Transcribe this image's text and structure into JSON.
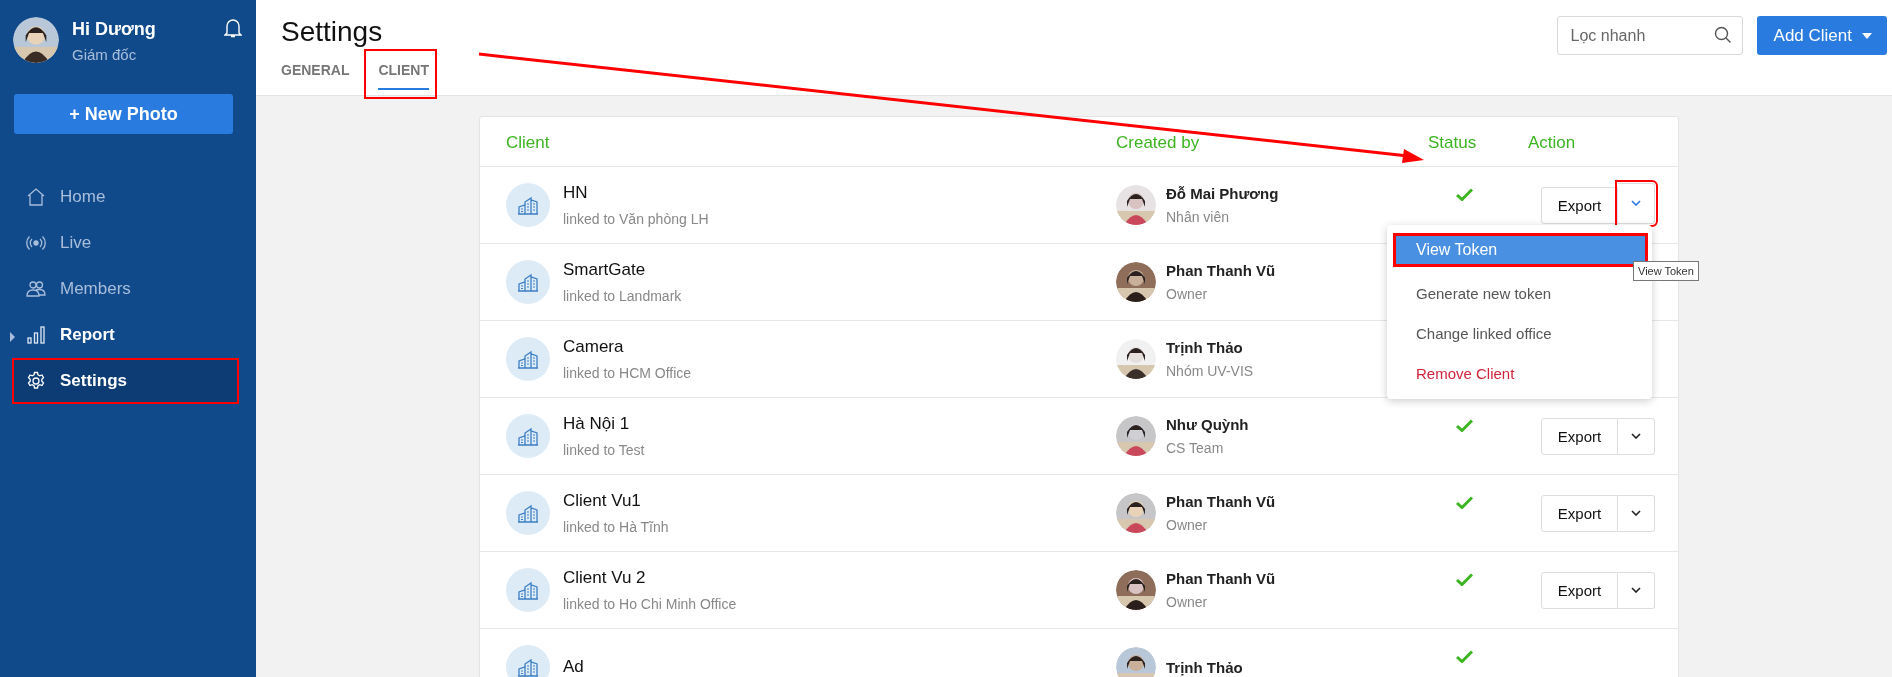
{
  "sidebar": {
    "user": {
      "name": "Hi Dương",
      "role": "Giám đốc"
    },
    "new_button": "+ New Photo",
    "items": [
      {
        "label": "Home",
        "kind": "link",
        "selected": false,
        "highlighted": false
      },
      {
        "label": "Live",
        "kind": "link",
        "selected": false,
        "highlighted": false
      },
      {
        "label": "Members",
        "kind": "link",
        "selected": false,
        "highlighted": false
      },
      {
        "label": "Report",
        "kind": "group",
        "expanded": false,
        "selected": false,
        "highlighted": false
      },
      {
        "label": "Settings",
        "kind": "link",
        "selected": true,
        "highlighted": true
      }
    ]
  },
  "header": {
    "title": "Settings",
    "tabs": [
      {
        "label": "GENERAL",
        "selected": false,
        "highlighted": false
      },
      {
        "label": "CLIENT",
        "selected": true,
        "highlighted": true
      }
    ],
    "search": {
      "placeholder": "Lọc nhanh"
    },
    "add_button": "Add Client"
  },
  "table": {
    "columns": [
      "Client",
      "Created by",
      "Status",
      "Action"
    ],
    "rows": [
      {
        "client": "HN",
        "linked": "linked to Văn phòng LH",
        "creator": "Đỗ Mai Phương",
        "creator_role": "Nhân viên",
        "active": true,
        "export": "Export",
        "menu_open": true
      },
      {
        "client": "SmartGate",
        "linked": "linked to Landmark",
        "creator": "Phan Thanh Vũ",
        "creator_role": "Owner"
      },
      {
        "client": "Camera",
        "linked": "linked to HCM Office",
        "creator": "Trịnh Thảo",
        "creator_role": "Nhóm UV-VIS"
      },
      {
        "client": "Hà Nội 1",
        "linked": "linked to Test",
        "creator": "Như Quỳnh",
        "creator_role": "CS Team",
        "active": true,
        "export": "Export",
        "menu_open": false
      },
      {
        "client": "Client Vu1",
        "linked": "linked to Hà Tĩnh",
        "creator": "Phan Thanh Vũ",
        "creator_role": "Owner",
        "active": true,
        "export": "Export",
        "menu_open": false
      },
      {
        "client": "Client Vu 2",
        "linked": "linked to Ho Chi Minh Office",
        "creator": "Phan Thanh Vũ",
        "creator_role": "Owner",
        "active": true,
        "export": "Export",
        "menu_open": false
      },
      {
        "client": "Ad",
        "creator": "Trịnh Thảo",
        "active": true
      }
    ]
  },
  "menu": {
    "items": [
      {
        "label": "View Token",
        "kind": "normal",
        "selected": true,
        "highlighted": true
      },
      {
        "label": "Generate new token",
        "kind": "normal",
        "selected": false,
        "highlighted": false
      },
      {
        "label": "Change linked office",
        "kind": "normal",
        "selected": false,
        "highlighted": false
      },
      {
        "label": "Remove Client",
        "kind": "danger",
        "selected": false,
        "highlighted": false
      }
    ]
  },
  "tooltip": "View Token",
  "callout_arrow": true
}
